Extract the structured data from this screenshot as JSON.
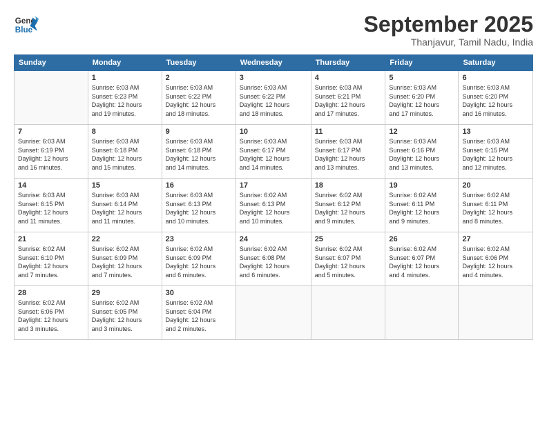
{
  "logo": {
    "line1": "General",
    "line2": "Blue"
  },
  "title": "September 2025",
  "subtitle": "Thanjavur, Tamil Nadu, India",
  "days_of_week": [
    "Sunday",
    "Monday",
    "Tuesday",
    "Wednesday",
    "Thursday",
    "Friday",
    "Saturday"
  ],
  "weeks": [
    [
      {
        "day": "",
        "info": ""
      },
      {
        "day": "1",
        "info": "Sunrise: 6:03 AM\nSunset: 6:23 PM\nDaylight: 12 hours\nand 19 minutes."
      },
      {
        "day": "2",
        "info": "Sunrise: 6:03 AM\nSunset: 6:22 PM\nDaylight: 12 hours\nand 18 minutes."
      },
      {
        "day": "3",
        "info": "Sunrise: 6:03 AM\nSunset: 6:22 PM\nDaylight: 12 hours\nand 18 minutes."
      },
      {
        "day": "4",
        "info": "Sunrise: 6:03 AM\nSunset: 6:21 PM\nDaylight: 12 hours\nand 17 minutes."
      },
      {
        "day": "5",
        "info": "Sunrise: 6:03 AM\nSunset: 6:20 PM\nDaylight: 12 hours\nand 17 minutes."
      },
      {
        "day": "6",
        "info": "Sunrise: 6:03 AM\nSunset: 6:20 PM\nDaylight: 12 hours\nand 16 minutes."
      }
    ],
    [
      {
        "day": "7",
        "info": "Sunrise: 6:03 AM\nSunset: 6:19 PM\nDaylight: 12 hours\nand 16 minutes."
      },
      {
        "day": "8",
        "info": "Sunrise: 6:03 AM\nSunset: 6:18 PM\nDaylight: 12 hours\nand 15 minutes."
      },
      {
        "day": "9",
        "info": "Sunrise: 6:03 AM\nSunset: 6:18 PM\nDaylight: 12 hours\nand 14 minutes."
      },
      {
        "day": "10",
        "info": "Sunrise: 6:03 AM\nSunset: 6:17 PM\nDaylight: 12 hours\nand 14 minutes."
      },
      {
        "day": "11",
        "info": "Sunrise: 6:03 AM\nSunset: 6:17 PM\nDaylight: 12 hours\nand 13 minutes."
      },
      {
        "day": "12",
        "info": "Sunrise: 6:03 AM\nSunset: 6:16 PM\nDaylight: 12 hours\nand 13 minutes."
      },
      {
        "day": "13",
        "info": "Sunrise: 6:03 AM\nSunset: 6:15 PM\nDaylight: 12 hours\nand 12 minutes."
      }
    ],
    [
      {
        "day": "14",
        "info": "Sunrise: 6:03 AM\nSunset: 6:15 PM\nDaylight: 12 hours\nand 11 minutes."
      },
      {
        "day": "15",
        "info": "Sunrise: 6:03 AM\nSunset: 6:14 PM\nDaylight: 12 hours\nand 11 minutes."
      },
      {
        "day": "16",
        "info": "Sunrise: 6:03 AM\nSunset: 6:13 PM\nDaylight: 12 hours\nand 10 minutes."
      },
      {
        "day": "17",
        "info": "Sunrise: 6:02 AM\nSunset: 6:13 PM\nDaylight: 12 hours\nand 10 minutes."
      },
      {
        "day": "18",
        "info": "Sunrise: 6:02 AM\nSunset: 6:12 PM\nDaylight: 12 hours\nand 9 minutes."
      },
      {
        "day": "19",
        "info": "Sunrise: 6:02 AM\nSunset: 6:11 PM\nDaylight: 12 hours\nand 9 minutes."
      },
      {
        "day": "20",
        "info": "Sunrise: 6:02 AM\nSunset: 6:11 PM\nDaylight: 12 hours\nand 8 minutes."
      }
    ],
    [
      {
        "day": "21",
        "info": "Sunrise: 6:02 AM\nSunset: 6:10 PM\nDaylight: 12 hours\nand 7 minutes."
      },
      {
        "day": "22",
        "info": "Sunrise: 6:02 AM\nSunset: 6:09 PM\nDaylight: 12 hours\nand 7 minutes."
      },
      {
        "day": "23",
        "info": "Sunrise: 6:02 AM\nSunset: 6:09 PM\nDaylight: 12 hours\nand 6 minutes."
      },
      {
        "day": "24",
        "info": "Sunrise: 6:02 AM\nSunset: 6:08 PM\nDaylight: 12 hours\nand 6 minutes."
      },
      {
        "day": "25",
        "info": "Sunrise: 6:02 AM\nSunset: 6:07 PM\nDaylight: 12 hours\nand 5 minutes."
      },
      {
        "day": "26",
        "info": "Sunrise: 6:02 AM\nSunset: 6:07 PM\nDaylight: 12 hours\nand 4 minutes."
      },
      {
        "day": "27",
        "info": "Sunrise: 6:02 AM\nSunset: 6:06 PM\nDaylight: 12 hours\nand 4 minutes."
      }
    ],
    [
      {
        "day": "28",
        "info": "Sunrise: 6:02 AM\nSunset: 6:06 PM\nDaylight: 12 hours\nand 3 minutes."
      },
      {
        "day": "29",
        "info": "Sunrise: 6:02 AM\nSunset: 6:05 PM\nDaylight: 12 hours\nand 3 minutes."
      },
      {
        "day": "30",
        "info": "Sunrise: 6:02 AM\nSunset: 6:04 PM\nDaylight: 12 hours\nand 2 minutes."
      },
      {
        "day": "",
        "info": ""
      },
      {
        "day": "",
        "info": ""
      },
      {
        "day": "",
        "info": ""
      },
      {
        "day": "",
        "info": ""
      }
    ]
  ]
}
